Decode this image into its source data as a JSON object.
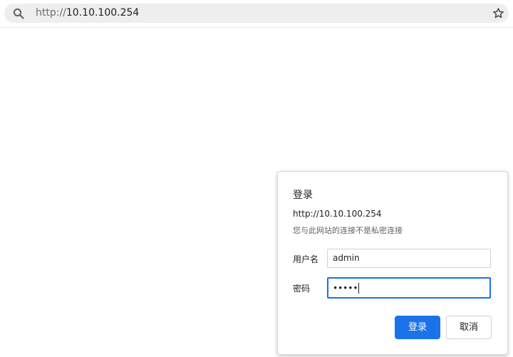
{
  "address_bar": {
    "url_scheme": "http://",
    "url_host": "10.10.100.254"
  },
  "login_dialog": {
    "title": "登录",
    "site_url": "http://10.10.100.254",
    "warning": "您与此网站的连接不是私密连接",
    "username_label": "用户名",
    "username_value": "admin",
    "password_label": "密码",
    "password_masked": "•••••",
    "login_button": "登录",
    "cancel_button": "取消"
  },
  "colors": {
    "accent": "#1a73e8",
    "omnibox_bg": "#eeeeee"
  }
}
